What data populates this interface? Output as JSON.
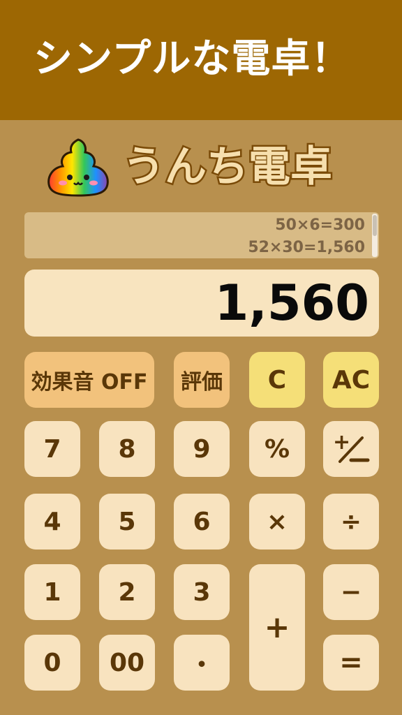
{
  "banner": {
    "title": "シンプルな電卓！"
  },
  "app": {
    "title": "うんち電卓",
    "logo_icon": "rainbow-poop-icon"
  },
  "history": {
    "lines": [
      "50×6=300",
      "52×30=1,560"
    ]
  },
  "display": {
    "value": "1,560"
  },
  "keys": {
    "sound": "効果音 OFF",
    "rate": "評価",
    "c": "C",
    "ac": "AC",
    "k7": "7",
    "k8": "8",
    "k9": "9",
    "percent": "%",
    "plusminus": "+/−",
    "k4": "4",
    "k5": "5",
    "k6": "6",
    "times": "×",
    "divide": "÷",
    "k1": "1",
    "k2": "2",
    "k3": "3",
    "plus": "+",
    "minus": "−",
    "k0": "0",
    "k00": "00",
    "dot": "・",
    "equals": "="
  },
  "colors": {
    "banner": "#9d6703",
    "background": "#b8904e",
    "key": "#f8e3bf",
    "key_orange": "#f2c27c",
    "key_yellow": "#f5df78",
    "key_text": "#5a3708"
  }
}
